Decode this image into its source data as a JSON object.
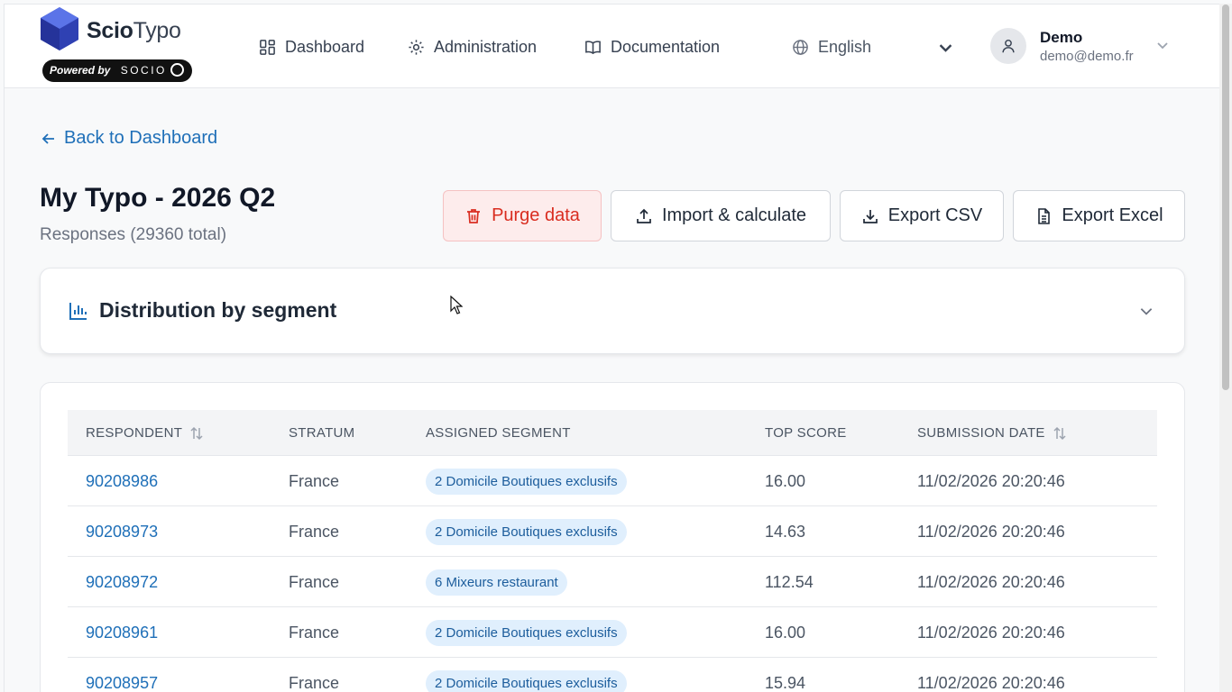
{
  "brand": {
    "name_bold": "Scio",
    "name_light": "Typo",
    "powered_by": "Powered by",
    "powered_brand": "SOCIO"
  },
  "nav": [
    {
      "label": "Dashboard",
      "icon": "grid-icon"
    },
    {
      "label": "Administration",
      "icon": "gear-icon"
    },
    {
      "label": "Documentation",
      "icon": "book-icon"
    }
  ],
  "language": {
    "selected": "English",
    "icon": "globe-icon"
  },
  "user": {
    "name": "Demo",
    "email": "demo@demo.fr"
  },
  "back_link": "Back to Dashboard",
  "page": {
    "title": "My Typo - 2026 Q2",
    "subtitle": "Responses (29360 total)"
  },
  "actions": {
    "purge": "Purge data",
    "import": "Import & calculate",
    "export_csv": "Export CSV",
    "export_excel": "Export Excel"
  },
  "distribution": {
    "title": "Distribution by segment"
  },
  "table": {
    "columns": [
      "RESPONDENT",
      "STRATUM",
      "ASSIGNED SEGMENT",
      "TOP SCORE",
      "SUBMISSION DATE"
    ],
    "rows": [
      {
        "respondent": "90208986",
        "stratum": "France",
        "segment": "2 Domicile Boutiques exclusifs",
        "score": "16.00",
        "date": "11/02/2026 20:20:46"
      },
      {
        "respondent": "90208973",
        "stratum": "France",
        "segment": "2 Domicile Boutiques exclusifs",
        "score": "14.63",
        "date": "11/02/2026 20:20:46"
      },
      {
        "respondent": "90208972",
        "stratum": "France",
        "segment": "6 Mixeurs restaurant",
        "score": "112.54",
        "date": "11/02/2026 20:20:46"
      },
      {
        "respondent": "90208961",
        "stratum": "France",
        "segment": "2 Domicile Boutiques exclusifs",
        "score": "16.00",
        "date": "11/02/2026 20:20:46"
      },
      {
        "respondent": "90208957",
        "stratum": "France",
        "segment": "2 Domicile Boutiques exclusifs",
        "score": "15.94",
        "date": "11/02/2026 20:20:46"
      }
    ]
  },
  "colors": {
    "accent": "#1e6fb8",
    "danger": "#d92d20",
    "danger_bg": "#fdecec",
    "badge_bg": "#e0effd"
  }
}
